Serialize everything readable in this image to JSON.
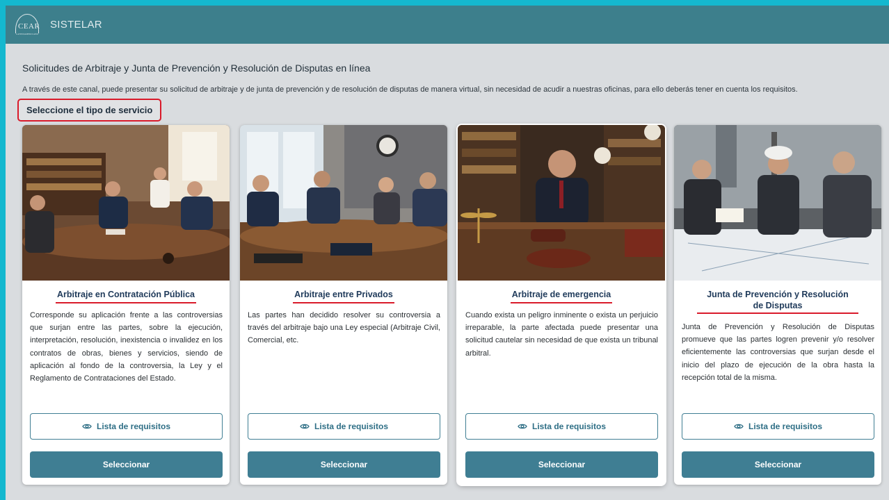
{
  "header": {
    "logo_text": "CEAR",
    "logo_subtext": "LATINOAMERICANO",
    "app_name": "SISTELAR"
  },
  "page": {
    "title": "Solicitudes de Arbitraje y Junta de Prevención y Resolución de Disputas en línea",
    "description": "A través de este canal, puede presentar su solicitud de arbitraje y de junta de prevención y de resolución de disputas de manera virtual, sin necesidad de acudir a nuestras oficinas, para ello deberás tener en cuenta los requisitos.",
    "section_label": "Seleccione el tipo de servicio"
  },
  "cards": [
    {
      "title": "Arbitraje en Contratación Pública",
      "description": "Corresponde su aplicación frente a las controversias que surjan entre las partes, sobre la ejecución, interpretación, resolución, inexistencia o invalidez en los contratos de obras, bienes y servicios, siendo de aplicación al fondo de la controversia, la Ley y el Reglamento de Contrataciones del Estado.",
      "requirements_label": "Lista de requisitos",
      "select_label": "Seleccionar"
    },
    {
      "title": "Arbitraje entre Privados",
      "description": "Las partes han decidido resolver su controversia a través del arbitraje bajo una Ley especial (Arbitraje Civil, Comercial, etc.",
      "requirements_label": "Lista de requisitos",
      "select_label": "Seleccionar"
    },
    {
      "title": "Arbitraje de emergencia",
      "description": "Cuando exista un peligro inminente o exista un perjuicio irreparable, la parte afectada puede presentar una solicitud cautelar sin necesidad de que exista un tribunal arbitral.",
      "requirements_label": "Lista de requisitos",
      "select_label": "Seleccionar"
    },
    {
      "title": "Junta de Prevención y Resolución de Disputas",
      "description": "Junta de Prevención y Resolución de Disputas promueve que las partes logren prevenir y/o resolver eficientemente las controversias que surjan desde el inicio del plazo de ejecución de la obra hasta la recepción total de la misma.",
      "requirements_label": "Lista de requisitos",
      "select_label": "Seleccionar"
    }
  ],
  "colors": {
    "header_bg": "#3d7f8c",
    "primary": "#3f7e93",
    "title_underline": "#d91a2a",
    "outer_frame": "#14b8cf"
  },
  "icons": {
    "requirements": "eye-icon"
  }
}
